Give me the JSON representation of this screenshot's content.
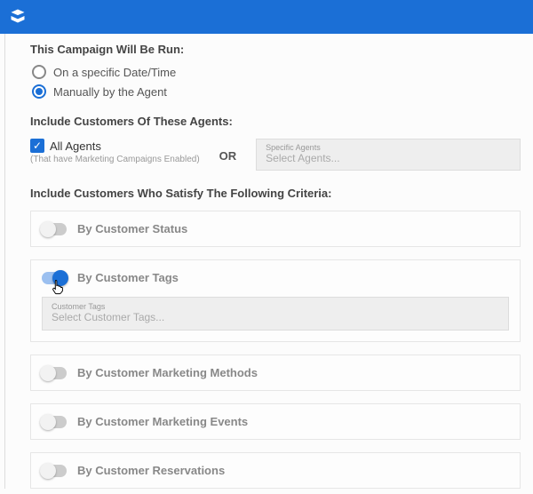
{
  "campaign": {
    "run_heading": "This Campaign Will Be Run:",
    "radio_specific": "On a specific Date/Time",
    "radio_manual": "Manually by the Agent"
  },
  "agents": {
    "heading": "Include Customers Of These Agents:",
    "all_label": "All Agents",
    "hint": "(That have Marketing Campaigns Enabled)",
    "or": "OR",
    "specific_label": "Specific Agents",
    "specific_placeholder": "Select Agents..."
  },
  "criteria": {
    "heading": "Include Customers Who Satisfy The Following Criteria:",
    "status": "By Customer Status",
    "tags": "By Customer Tags",
    "tags_select_label": "Customer Tags",
    "tags_select_placeholder": "Select Customer Tags...",
    "marketing_methods": "By Customer Marketing Methods",
    "marketing_events": "By Customer Marketing Events",
    "reservations": "By Customer Reservations"
  }
}
